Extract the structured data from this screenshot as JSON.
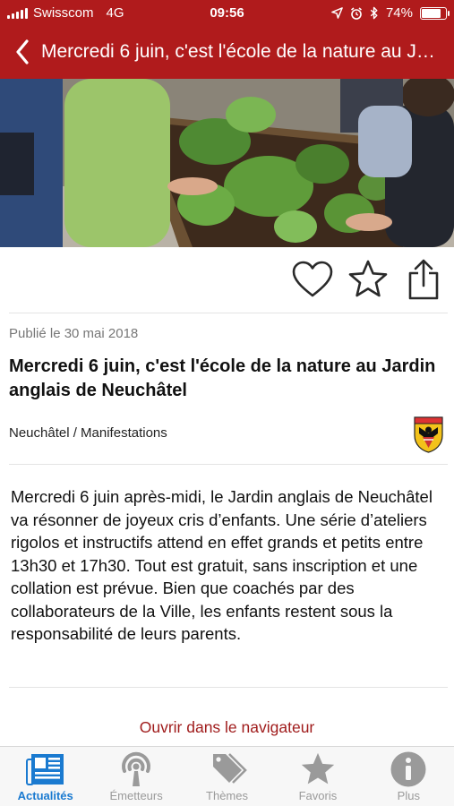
{
  "status_bar": {
    "carrier": "Swisscom",
    "network": "4G",
    "time": "09:56",
    "battery": "74%",
    "battery_level": 0.74,
    "icons": [
      "location-arrow-icon",
      "alarm-icon",
      "bluetooth-icon"
    ]
  },
  "nav": {
    "back_icon": "chevron-left-icon",
    "title": "Mercredi 6 juin, c'est l'école de la nature au Jardin anglais de Neuchâtel"
  },
  "hero": {
    "icon": "photo-children-garden"
  },
  "actions": [
    {
      "id": "favorite",
      "icon": "heart-icon"
    },
    {
      "id": "bookmark",
      "icon": "star-icon"
    },
    {
      "id": "share",
      "icon": "share-icon"
    }
  ],
  "article": {
    "published": "Publié le 30 mai 2018",
    "title": "Mercredi 6 juin, c'est l'école de la nature au Jardin anglais de Neuchâtel",
    "category": "Neuchâtel / Manifestations",
    "crest_icon": "neuchatel-crest-icon",
    "body": "Mercredi 6 juin après-midi, le Jardin anglais de Neuchâtel va résonner de joyeux cris d’enfants. Une série d’ateliers rigolos et instructifs attend en effet grands et petits entre 13h30 et 17h30. Tout est gratuit, sans inscription et une collation est prévue. Bien que coachés par des collaborateurs de la Ville, les enfants restent sous la responsabilité de leurs parents.",
    "open_link": "Ouvrir dans le navigateur"
  },
  "tabs": [
    {
      "label": "Actualités",
      "icon": "newspaper-icon",
      "active": true
    },
    {
      "label": "Émetteurs",
      "icon": "broadcast-icon",
      "active": false
    },
    {
      "label": "Thèmes",
      "icon": "tags-icon",
      "active": false
    },
    {
      "label": "Favoris",
      "icon": "star-icon",
      "active": false
    },
    {
      "label": "Plus",
      "icon": "info-icon",
      "active": false
    }
  ],
  "colors": {
    "brand_red": "#b01b1c",
    "link_red": "#a01c1c",
    "tab_active": "#1a7ad0",
    "tab_inactive": "#9a9a9a"
  }
}
